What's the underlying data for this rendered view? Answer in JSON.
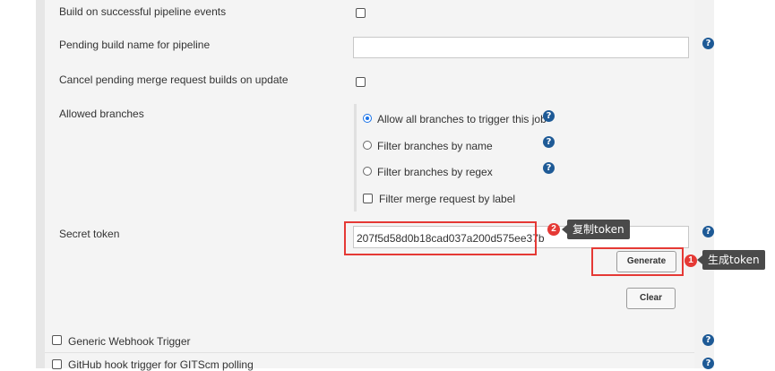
{
  "form": {
    "build_on_pipeline_label": "Build on successful pipeline events",
    "pending_build_name_label": "Pending build name for pipeline",
    "pending_build_name_value": "",
    "cancel_pending_label": "Cancel pending merge request builds on update",
    "allowed_branches_label": "Allowed branches",
    "branch_options": [
      {
        "label": "Allow all branches to trigger this job",
        "selected": true
      },
      {
        "label": "Filter branches by name",
        "selected": false
      },
      {
        "label": "Filter branches by regex",
        "selected": false
      }
    ],
    "filter_merge_label": "Filter merge request by label",
    "secret_token_label": "Secret token",
    "secret_token_value": "207f5d58d0b18cad037a200d575ee37b",
    "generate_button": "Generate",
    "clear_button": "Clear"
  },
  "triggers": {
    "generic_webhook_label": "Generic Webhook Trigger",
    "github_hook_label": "GitHub hook trigger for GITScm polling"
  },
  "help_icon": "?",
  "annotations": {
    "copy_badge": "2",
    "copy_tip": "复制token",
    "generate_badge": "1",
    "generate_tip": "生成token"
  },
  "colors": {
    "accent": "#1e5a96",
    "annotation_red": "#e53935",
    "tooltip_bg": "#4a4a4a"
  }
}
